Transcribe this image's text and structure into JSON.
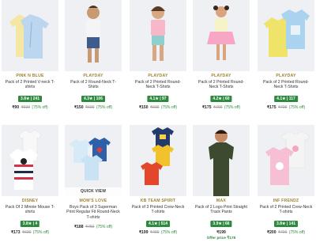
{
  "products": [
    {
      "brand": "PINK N BLUE",
      "title": "Pack of 2 Printed V-neck T-shirts",
      "rating": "3.8★ | 241",
      "price": "₹90",
      "mrp": "₹600",
      "discount": "(75% off)"
    },
    {
      "brand": "PLAYDAY",
      "title": "Pack of 2 Round-Neck T-Shirts",
      "rating": "4.3★ | 106",
      "price": "₹150",
      "mrp": "₹600",
      "discount": "(75% off)"
    },
    {
      "brand": "PLAYDAY",
      "title": "Pack of 2 Printed Round-Neck T-Shirts",
      "rating": "4.1★ | 97",
      "price": "₹150",
      "mrp": "₹600",
      "discount": "(75% off)"
    },
    {
      "brand": "PLAYDAY",
      "title": "Pack of 2 Printed Round-Neck T-Shirts",
      "rating": "4.2★ | 60",
      "price": "₹175",
      "mrp": "₹700",
      "discount": "(75% off)"
    },
    {
      "brand": "PLAYDAY",
      "title": "Pack of 2 Printed Round-Neck T-Shirts",
      "rating": "4.1★ | 117",
      "price": "₹175",
      "mrp": "₹700",
      "discount": "(75% off)"
    },
    {
      "brand": "DISNEY",
      "title": "Pack Of 2 Minnie Mouse T-shirts",
      "rating": "3.8★ | 4",
      "price": "₹173",
      "mrp": "₹690",
      "discount": "(75% off)"
    },
    {
      "brand": "MOM'S LOVE",
      "title": "Boys Pack of 3 Superman Print Regular Fit Round-Neck T-shirts",
      "rating": "",
      "price": "₹188",
      "mrp": "₹750",
      "discount": "(75% off)",
      "quick_view": "QUICK VIEW"
    },
    {
      "brand": "KB TEAM SPIRIT",
      "title": "Pack of 3 Printed Crew-Neck T-shirts",
      "rating": "4.1★ | 514",
      "price": "₹199",
      "mrp": "₹499",
      "discount": "(75% off)"
    },
    {
      "brand": "MAX",
      "title": "Pack of 2 Logo Print Straight Track Pants",
      "rating": "3.9★ | 66",
      "price": "₹199",
      "mrp": "",
      "discount": "",
      "offer": "Offer price ₹175"
    },
    {
      "brand": "INF FRENDZ",
      "title": "Pack of 2 Printed Crew-Neck T-shirts",
      "rating": "3.8★ | 141",
      "price": "₹200",
      "mrp": "₹799",
      "discount": "(75% off)"
    }
  ],
  "colors": {
    "brand": "#a0842f",
    "rating_bg": "#2b8a3e",
    "discount": "#2b8a3e"
  }
}
